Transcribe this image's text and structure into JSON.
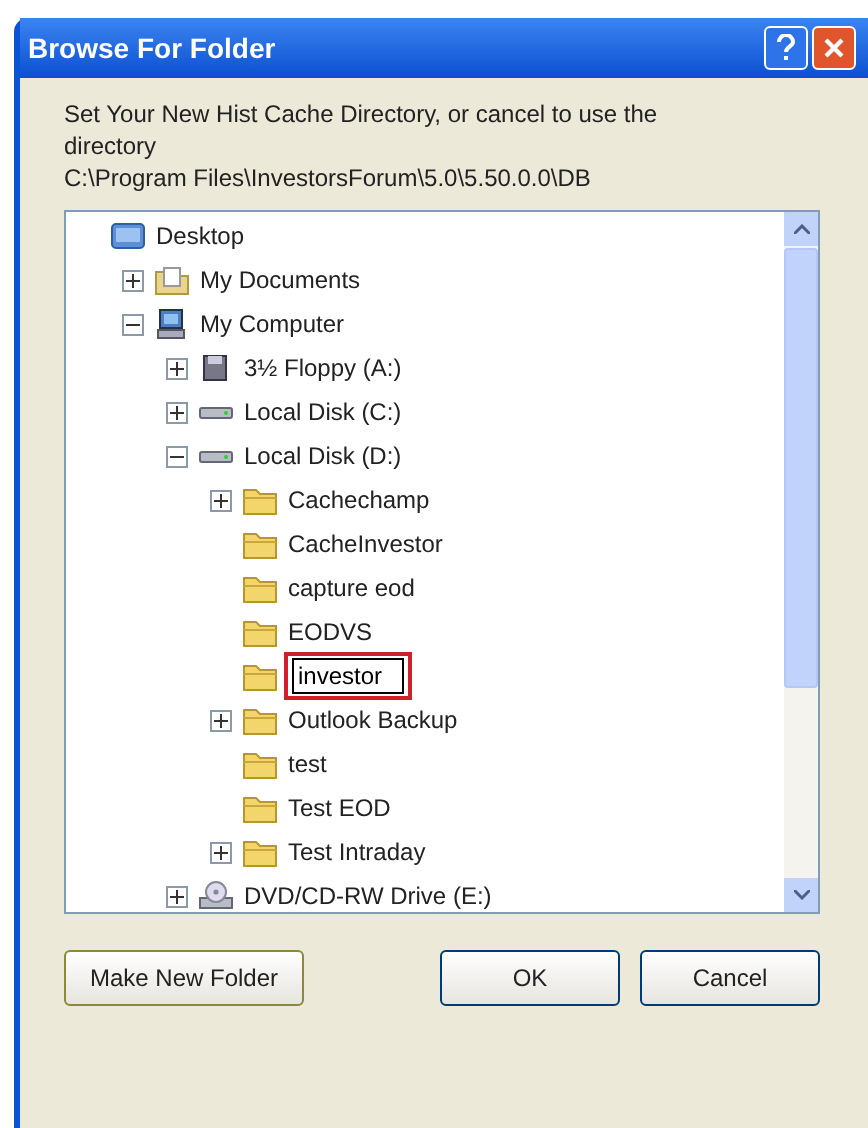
{
  "window": {
    "title": "Browse For Folder"
  },
  "instructions": "Set Your New Hist Cache Directory, or cancel to use the directory",
  "current_path": "C:\\Program Files\\InvestorsForum\\5.0\\5.50.0.0\\DB",
  "tree": [
    {
      "kind": "desktop",
      "label": "Desktop",
      "has_expander": false,
      "children": [
        {
          "kind": "documents",
          "label": "My Documents",
          "has_expander": true,
          "expanded": false
        },
        {
          "kind": "computer",
          "label": "My Computer",
          "has_expander": true,
          "expanded": true,
          "children": [
            {
              "kind": "floppy",
              "label": "3½ Floppy (A:)",
              "has_expander": true,
              "expanded": false
            },
            {
              "kind": "disk",
              "label": "Local Disk (C:)",
              "has_expander": true,
              "expanded": false
            },
            {
              "kind": "disk",
              "label": "Local Disk (D:)",
              "has_expander": true,
              "expanded": true,
              "children": [
                {
                  "kind": "folder",
                  "label": "Cachechamp",
                  "has_expander": true,
                  "expanded": false
                },
                {
                  "kind": "folder",
                  "label": "CacheInvestor",
                  "has_expander": false,
                  "expanded": false
                },
                {
                  "kind": "folder",
                  "label": "capture eod",
                  "has_expander": false,
                  "expanded": false
                },
                {
                  "kind": "folder",
                  "label": "EODVS",
                  "has_expander": false,
                  "expanded": false
                },
                {
                  "kind": "rename",
                  "label": "investor",
                  "has_expander": false,
                  "expanded": false
                },
                {
                  "kind": "folder",
                  "label": "Outlook Backup",
                  "has_expander": true,
                  "expanded": false
                },
                {
                  "kind": "folder",
                  "label": "test",
                  "has_expander": false,
                  "expanded": false
                },
                {
                  "kind": "folder",
                  "label": "Test EOD",
                  "has_expander": false,
                  "expanded": false
                },
                {
                  "kind": "folder",
                  "label": "Test Intraday",
                  "has_expander": true,
                  "expanded": false
                }
              ]
            },
            {
              "kind": "dvd",
              "label": "DVD/CD-RW Drive (E:)",
              "has_expander": true,
              "expanded": false
            }
          ]
        }
      ]
    }
  ],
  "buttons": [
    "Make New Folder",
    "OK",
    "Cancel"
  ]
}
